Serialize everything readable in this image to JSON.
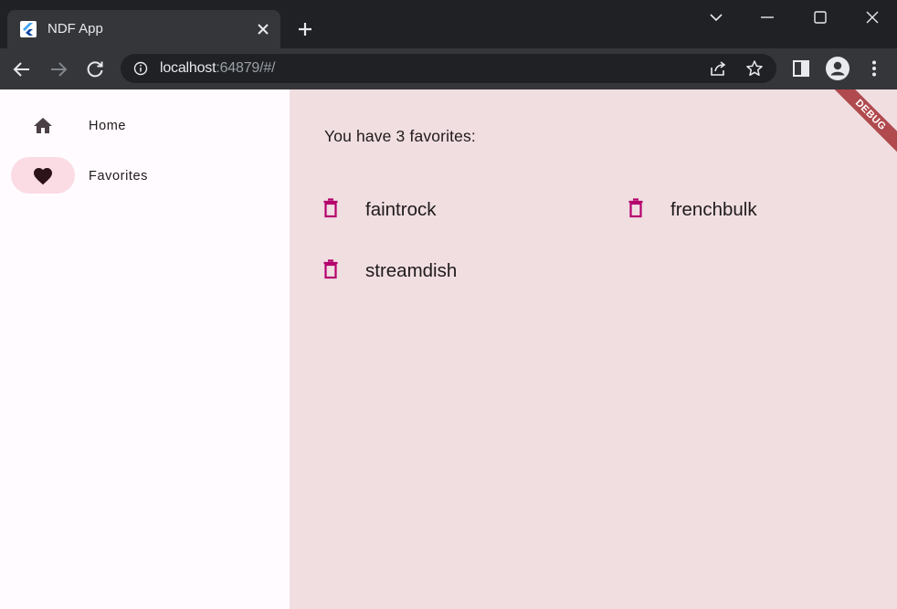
{
  "browser": {
    "tab_title": "NDF App",
    "url_host": "localhost",
    "url_rest": ":64879/#/"
  },
  "icons": {
    "favicon": "flutter-icon",
    "tab_close": "close-icon",
    "new_tab": "plus-icon",
    "back": "back-arrow-icon",
    "forward": "forward-arrow-icon",
    "reload": "reload-icon",
    "site_info": "info-icon",
    "share": "share-icon",
    "bookmark": "star-icon",
    "side_panel": "side-panel-icon",
    "profile": "profile-icon",
    "menu": "more-vert-icon",
    "home": "home-icon",
    "favorites": "heart-icon",
    "delete": "trash-icon"
  },
  "rail": {
    "items": [
      {
        "label": "Home",
        "selected": false
      },
      {
        "label": "Favorites",
        "selected": true
      }
    ]
  },
  "content": {
    "count_text": "You have 3 favorites:",
    "favorites": [
      "faintrock",
      "frenchbulk",
      "streamdish"
    ]
  },
  "debug_banner": "DEBUG",
  "colors": {
    "accent": "#b5006d",
    "rail_indicator": "#fbdbe4",
    "content_bg": "#f0dee1",
    "rail_bg": "#fffbfe",
    "debug_banner": "#b04a4e"
  }
}
